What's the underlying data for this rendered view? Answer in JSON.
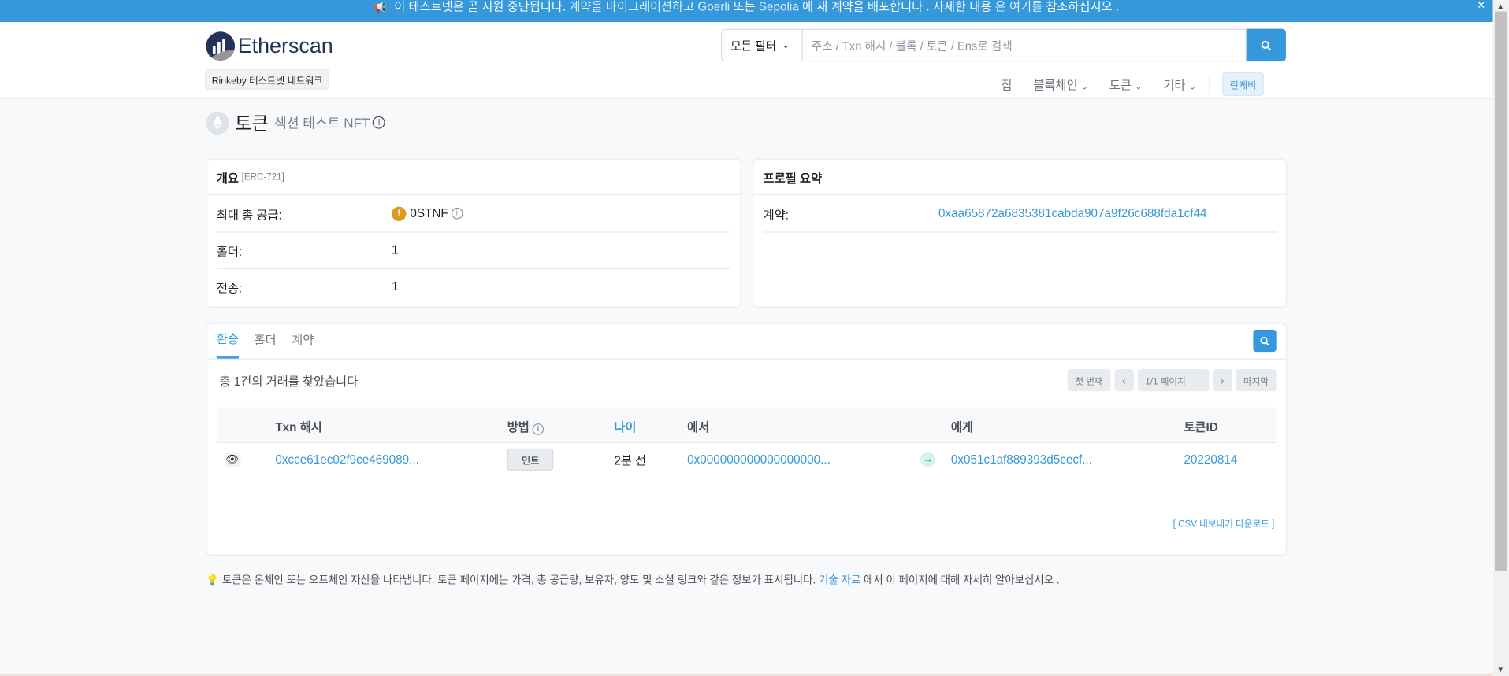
{
  "announcement": {
    "speaker_icon": "megaphone-icon",
    "part1": "이 테스트넷은 곧 지원 중단됩니다.",
    "part2": "계약을 마이그레이션하고",
    "goerli": "Goerli",
    "or": "또는",
    "sepolia": "Sepolia",
    "part3": "에 새 계약을 배포합니다 . 자세한 내용",
    "eun": "은",
    "here": "여기를",
    "part4": "참조하십시오 .",
    "close": "×"
  },
  "header": {
    "logo_text": "Etherscan",
    "network_badge": "Rinkeby 테스트넷 네트워크",
    "search": {
      "filter_label": "모든 필터",
      "placeholder": "주소 / Txn 해시 / 블록 / 토큰 / Ens로 검색"
    },
    "nav": {
      "home": "집",
      "blockchain": "블록체인",
      "tokens": "토큰",
      "more": "기타",
      "network": "린케비"
    }
  },
  "page": {
    "title": "토큰",
    "subtitle": "섹션 테스트 NFT"
  },
  "overview": {
    "title": "개요",
    "standard": "[ERC-721]",
    "rows": {
      "supply_label": "최대 총 공급:",
      "supply_value": "0STNF",
      "holders_label": "홀더:",
      "holders_value": "1",
      "transfers_label": "전송:",
      "transfers_value": "1"
    }
  },
  "profile": {
    "title": "프로필 요약",
    "contract_label": "계약:",
    "contract_value": "0xaa65872a6835381cabda907a9f26c688fda1cf44"
  },
  "transfers": {
    "tabs": [
      "환승",
      "홀더",
      "계약"
    ],
    "found_text": "총 1건의 거래를 찾았습니다",
    "pager": {
      "first": "첫 번째",
      "prev": "‹",
      "page": "1/1 페이지 _ _",
      "next": "›",
      "last": "마지막"
    },
    "columns": {
      "txn": "Txn 해시",
      "method": "방법",
      "age": "나이",
      "from": "에서",
      "to": "에게",
      "token_id": "토큰ID"
    },
    "rows": [
      {
        "txn": "0xcce61ec02f9ce469089...",
        "method": "민트",
        "age": "2분 전",
        "from": "0x000000000000000000...",
        "to": "0x051c1af889393d5cecf...",
        "token_id": "20220814"
      }
    ],
    "csv": "[ CSV 내보내기 다운로드 ]"
  },
  "footnote": {
    "text": "토큰은 온체인 또는 오프체인 자산을 나타냅니다. 토큰 페이지에는 가격, 총 공급량, 보유자, 양도 및 소셜 링크와 같은 정보가 표시됩니다.",
    "link": "기술 자료",
    "tail": "에서 이 페이지에 대해 자세히 알아보십시오 ."
  },
  "colors": {
    "accent": "#3498db",
    "dark": "#21325b",
    "warning": "#dc9b1a",
    "success": "#00a186"
  }
}
